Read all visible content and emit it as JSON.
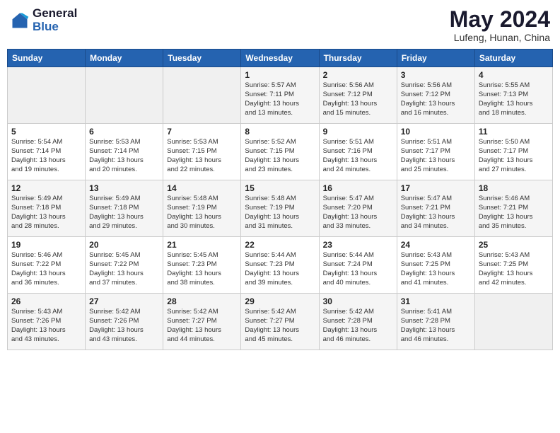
{
  "header": {
    "logo_line1": "General",
    "logo_line2": "Blue",
    "month": "May 2024",
    "location": "Lufeng, Hunan, China"
  },
  "weekdays": [
    "Sunday",
    "Monday",
    "Tuesday",
    "Wednesday",
    "Thursday",
    "Friday",
    "Saturday"
  ],
  "weeks": [
    [
      {
        "day": "",
        "info": ""
      },
      {
        "day": "",
        "info": ""
      },
      {
        "day": "",
        "info": ""
      },
      {
        "day": "1",
        "info": "Sunrise: 5:57 AM\nSunset: 7:11 PM\nDaylight: 13 hours\nand 13 minutes."
      },
      {
        "day": "2",
        "info": "Sunrise: 5:56 AM\nSunset: 7:12 PM\nDaylight: 13 hours\nand 15 minutes."
      },
      {
        "day": "3",
        "info": "Sunrise: 5:56 AM\nSunset: 7:12 PM\nDaylight: 13 hours\nand 16 minutes."
      },
      {
        "day": "4",
        "info": "Sunrise: 5:55 AM\nSunset: 7:13 PM\nDaylight: 13 hours\nand 18 minutes."
      }
    ],
    [
      {
        "day": "5",
        "info": "Sunrise: 5:54 AM\nSunset: 7:14 PM\nDaylight: 13 hours\nand 19 minutes."
      },
      {
        "day": "6",
        "info": "Sunrise: 5:53 AM\nSunset: 7:14 PM\nDaylight: 13 hours\nand 20 minutes."
      },
      {
        "day": "7",
        "info": "Sunrise: 5:53 AM\nSunset: 7:15 PM\nDaylight: 13 hours\nand 22 minutes."
      },
      {
        "day": "8",
        "info": "Sunrise: 5:52 AM\nSunset: 7:15 PM\nDaylight: 13 hours\nand 23 minutes."
      },
      {
        "day": "9",
        "info": "Sunrise: 5:51 AM\nSunset: 7:16 PM\nDaylight: 13 hours\nand 24 minutes."
      },
      {
        "day": "10",
        "info": "Sunrise: 5:51 AM\nSunset: 7:17 PM\nDaylight: 13 hours\nand 25 minutes."
      },
      {
        "day": "11",
        "info": "Sunrise: 5:50 AM\nSunset: 7:17 PM\nDaylight: 13 hours\nand 27 minutes."
      }
    ],
    [
      {
        "day": "12",
        "info": "Sunrise: 5:49 AM\nSunset: 7:18 PM\nDaylight: 13 hours\nand 28 minutes."
      },
      {
        "day": "13",
        "info": "Sunrise: 5:49 AM\nSunset: 7:18 PM\nDaylight: 13 hours\nand 29 minutes."
      },
      {
        "day": "14",
        "info": "Sunrise: 5:48 AM\nSunset: 7:19 PM\nDaylight: 13 hours\nand 30 minutes."
      },
      {
        "day": "15",
        "info": "Sunrise: 5:48 AM\nSunset: 7:19 PM\nDaylight: 13 hours\nand 31 minutes."
      },
      {
        "day": "16",
        "info": "Sunrise: 5:47 AM\nSunset: 7:20 PM\nDaylight: 13 hours\nand 33 minutes."
      },
      {
        "day": "17",
        "info": "Sunrise: 5:47 AM\nSunset: 7:21 PM\nDaylight: 13 hours\nand 34 minutes."
      },
      {
        "day": "18",
        "info": "Sunrise: 5:46 AM\nSunset: 7:21 PM\nDaylight: 13 hours\nand 35 minutes."
      }
    ],
    [
      {
        "day": "19",
        "info": "Sunrise: 5:46 AM\nSunset: 7:22 PM\nDaylight: 13 hours\nand 36 minutes."
      },
      {
        "day": "20",
        "info": "Sunrise: 5:45 AM\nSunset: 7:22 PM\nDaylight: 13 hours\nand 37 minutes."
      },
      {
        "day": "21",
        "info": "Sunrise: 5:45 AM\nSunset: 7:23 PM\nDaylight: 13 hours\nand 38 minutes."
      },
      {
        "day": "22",
        "info": "Sunrise: 5:44 AM\nSunset: 7:23 PM\nDaylight: 13 hours\nand 39 minutes."
      },
      {
        "day": "23",
        "info": "Sunrise: 5:44 AM\nSunset: 7:24 PM\nDaylight: 13 hours\nand 40 minutes."
      },
      {
        "day": "24",
        "info": "Sunrise: 5:43 AM\nSunset: 7:25 PM\nDaylight: 13 hours\nand 41 minutes."
      },
      {
        "day": "25",
        "info": "Sunrise: 5:43 AM\nSunset: 7:25 PM\nDaylight: 13 hours\nand 42 minutes."
      }
    ],
    [
      {
        "day": "26",
        "info": "Sunrise: 5:43 AM\nSunset: 7:26 PM\nDaylight: 13 hours\nand 43 minutes."
      },
      {
        "day": "27",
        "info": "Sunrise: 5:42 AM\nSunset: 7:26 PM\nDaylight: 13 hours\nand 43 minutes."
      },
      {
        "day": "28",
        "info": "Sunrise: 5:42 AM\nSunset: 7:27 PM\nDaylight: 13 hours\nand 44 minutes."
      },
      {
        "day": "29",
        "info": "Sunrise: 5:42 AM\nSunset: 7:27 PM\nDaylight: 13 hours\nand 45 minutes."
      },
      {
        "day": "30",
        "info": "Sunrise: 5:42 AM\nSunset: 7:28 PM\nDaylight: 13 hours\nand 46 minutes."
      },
      {
        "day": "31",
        "info": "Sunrise: 5:41 AM\nSunset: 7:28 PM\nDaylight: 13 hours\nand 46 minutes."
      },
      {
        "day": "",
        "info": ""
      }
    ]
  ]
}
